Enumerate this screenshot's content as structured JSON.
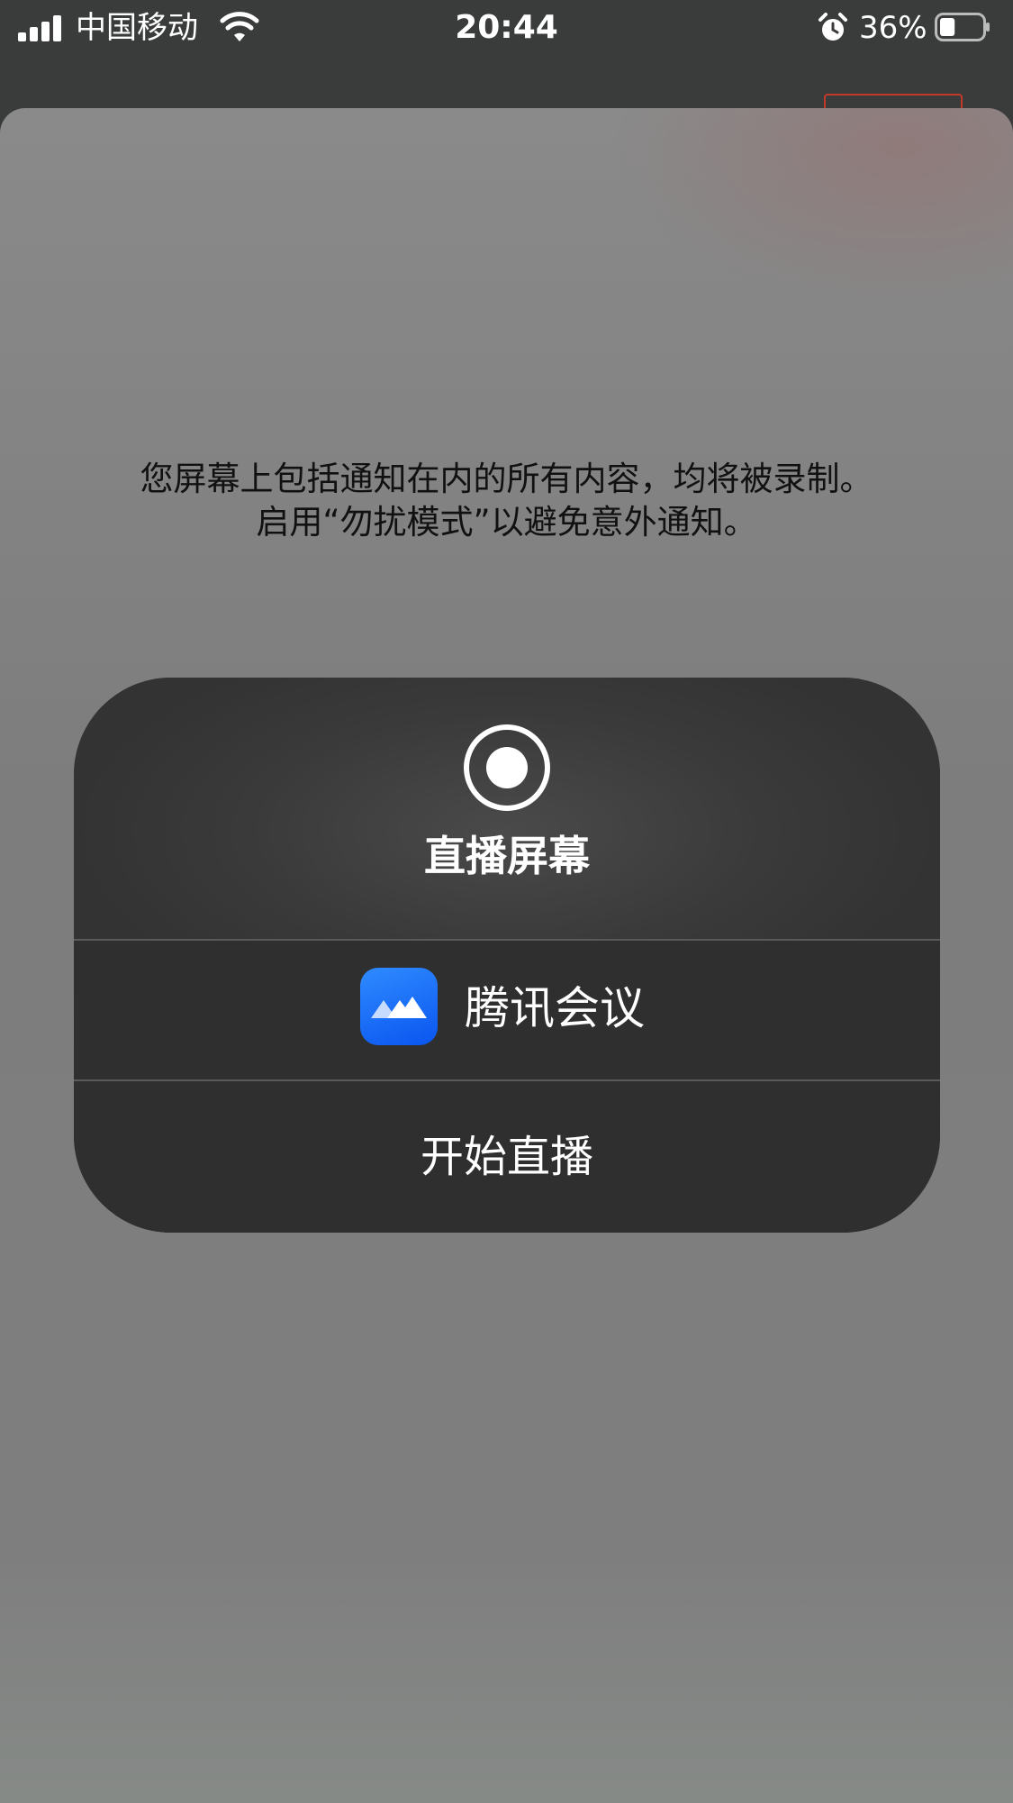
{
  "status_bar": {
    "carrier": "中国移动",
    "time": "20:44",
    "battery_percent": "36%",
    "battery_level": 0.36,
    "icons": [
      "signal-icon",
      "wifi-icon",
      "alarm-icon",
      "battery-icon"
    ]
  },
  "sheet": {
    "notice": "您屏幕上包括通知在内的所有内容，均将被录制。启用“勿扰模式”以避免意外通知。",
    "notice_line1": "您屏幕上包括通知在内的所有内容，均将被录制。",
    "notice_line2": "启用“勿扰模式”以避免意外通知。"
  },
  "card": {
    "title": "直播屏幕",
    "icon": "record-icon",
    "app": {
      "name": "腾讯会议",
      "icon": "tencent-meeting-icon"
    },
    "start_label": "开始直播"
  },
  "colors": {
    "sheet_background": "#808080",
    "card_background": "#2f2f2f",
    "app_icon_blue": "#0a55f0",
    "text_light": "#ffffff",
    "text_dark": "#111111"
  }
}
